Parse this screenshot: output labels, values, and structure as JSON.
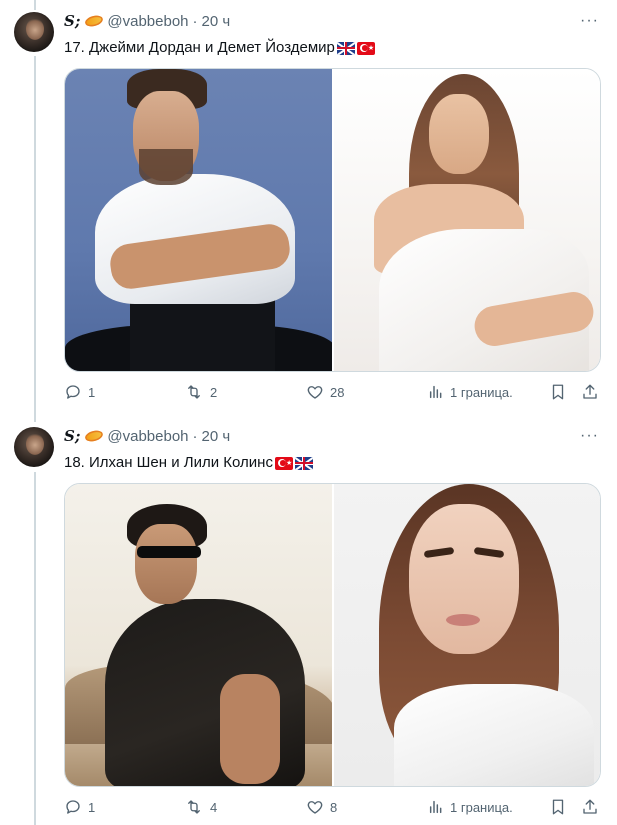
{
  "tweets": [
    {
      "display_name": "S;",
      "handle": "@vabbeboh",
      "separator": "·",
      "time": "20 ч",
      "text": "17. Джейми Дордан и Демет Йоздемир",
      "flags": [
        "uk-flag",
        "turkey-flag"
      ],
      "images": [
        "man-on-blue-background-photo",
        "woman-in-white-dress-photo"
      ],
      "actions": {
        "replies": "1",
        "retweets": "2",
        "likes": "28",
        "views": "1 граница."
      }
    },
    {
      "display_name": "S;",
      "handle": "@vabbeboh",
      "separator": "·",
      "time": "20 ч",
      "text": "18. Илхан Шен и Лили Колинс",
      "flags": [
        "turkey-flag",
        "uk-flag"
      ],
      "images": [
        "man-with-sunglasses-photo",
        "woman-in-white-shirt-photo"
      ],
      "actions": {
        "replies": "1",
        "retweets": "4",
        "likes": "8",
        "views": "1 граница."
      }
    }
  ],
  "colors": {
    "text": "#0f1419",
    "secondary": "#536471",
    "border": "#cfd9de",
    "background": "#ffffff"
  }
}
